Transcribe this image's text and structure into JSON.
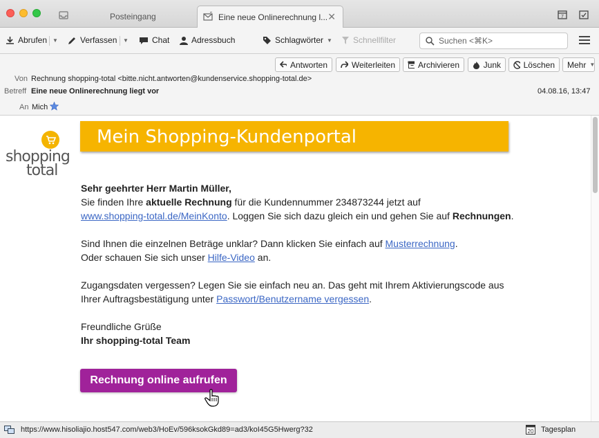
{
  "tabs": [
    {
      "label": "Posteingang",
      "active": false
    },
    {
      "label": "Eine neue Onlinerechnung l...",
      "active": true
    }
  ],
  "toolbar": {
    "abrufen": "Abrufen",
    "verfassen": "Verfassen",
    "chat": "Chat",
    "adressbuch": "Adressbuch",
    "schlagwoerter": "Schlagwörter",
    "schnellfilter": "Schnellfilter",
    "search_placeholder": "Suchen <⌘K>"
  },
  "actions": {
    "antworten": "Antworten",
    "weiterleiten": "Weiterleiten",
    "archivieren": "Archivieren",
    "junk": "Junk",
    "loeschen": "Löschen",
    "mehr": "Mehr"
  },
  "header": {
    "from_label": "Von",
    "from_value": "Rechnung shopping-total <bitte.nicht.antworten@kundenservice.shopping-total.de>",
    "subject_label": "Betreff",
    "subject_value": "Eine neue Onlinerechnung liegt vor",
    "date": "04.08.16, 13:47",
    "to_label": "An",
    "to_value": "Mich"
  },
  "message": {
    "logo_line1": "shopping",
    "logo_line2": "total",
    "banner": "Mein Shopping-Kundenportal",
    "greeting": "Sehr geehrter Herr Martin Müller,",
    "p1_a": "Sie finden Ihre ",
    "p1_b": "aktuelle Rechnung",
    "p1_c": " für die Kundennummer 234873244 jetzt auf",
    "p1_link": "www.shopping-total.de/MeinKonto",
    "p1_d": ". Loggen Sie sich dazu gleich ein und gehen Sie auf ",
    "p1_e": "Rechnungen",
    "p1_f": ".",
    "p2_a": "Sind Ihnen die einzelnen Beträge unklar? Dann klicken Sie einfach auf ",
    "p2_link": "Musterrechnung",
    "p2_b": ".",
    "p2_c": "Oder schauen Sie sich unser ",
    "p2_link2": "Hilfe-Video",
    "p2_d": " an.",
    "p3_a": "Zugangsdaten vergessen? Legen Sie sie einfach neu an. Das geht mit Ihrem Aktivierungscode aus",
    "p3_b": "Ihrer Auftragsbestätigung unter ",
    "p3_link": "Passwort/Benutzername vergessen",
    "p3_c": ".",
    "closing": "Freundliche Grüße",
    "signature": "Ihr shopping-total Team",
    "cta": "Rechnung online aufrufen"
  },
  "status": {
    "url": "https://www.hisoliajio.host547.com/web3/HoEv/596ksokGkd89=ad3/koI45G5Hwerg?32",
    "tagesplan": "Tagesplan",
    "calendar_day": "20"
  },
  "colors": {
    "banner": "#f6b400",
    "cta": "#a0229a",
    "link": "#3a66c4"
  }
}
